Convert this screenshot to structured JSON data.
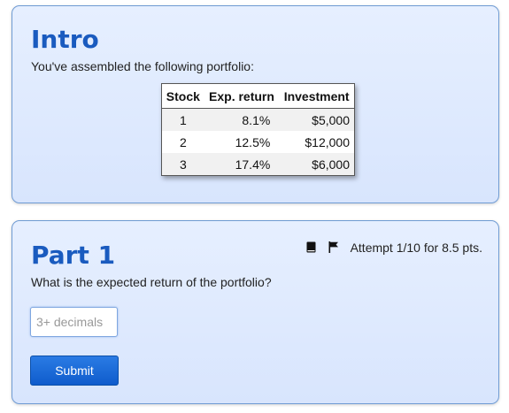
{
  "intro": {
    "title": "Intro",
    "text": "You've assembled the following portfolio:",
    "table": {
      "headers": [
        "Stock",
        "Exp. return",
        "Investment"
      ],
      "rows": [
        [
          "1",
          "8.1%",
          "$5,000"
        ],
        [
          "2",
          "12.5%",
          "$12,000"
        ],
        [
          "3",
          "17.4%",
          "$6,000"
        ]
      ]
    }
  },
  "part1": {
    "title": "Part 1",
    "question": "What is the expected return of the portfolio?",
    "attempt_text": "Attempt 1/10 for 8.5 pts.",
    "answer": {
      "value": "",
      "placeholder": "3+ decimals"
    },
    "submit_label": "Submit"
  },
  "colors": {
    "heading": "#1a5bbf",
    "card_border": "#6f9bd3",
    "card_background": "#e6efff",
    "submit_button": "#1666d6"
  },
  "icons": [
    "book-icon",
    "flag-icon"
  ]
}
